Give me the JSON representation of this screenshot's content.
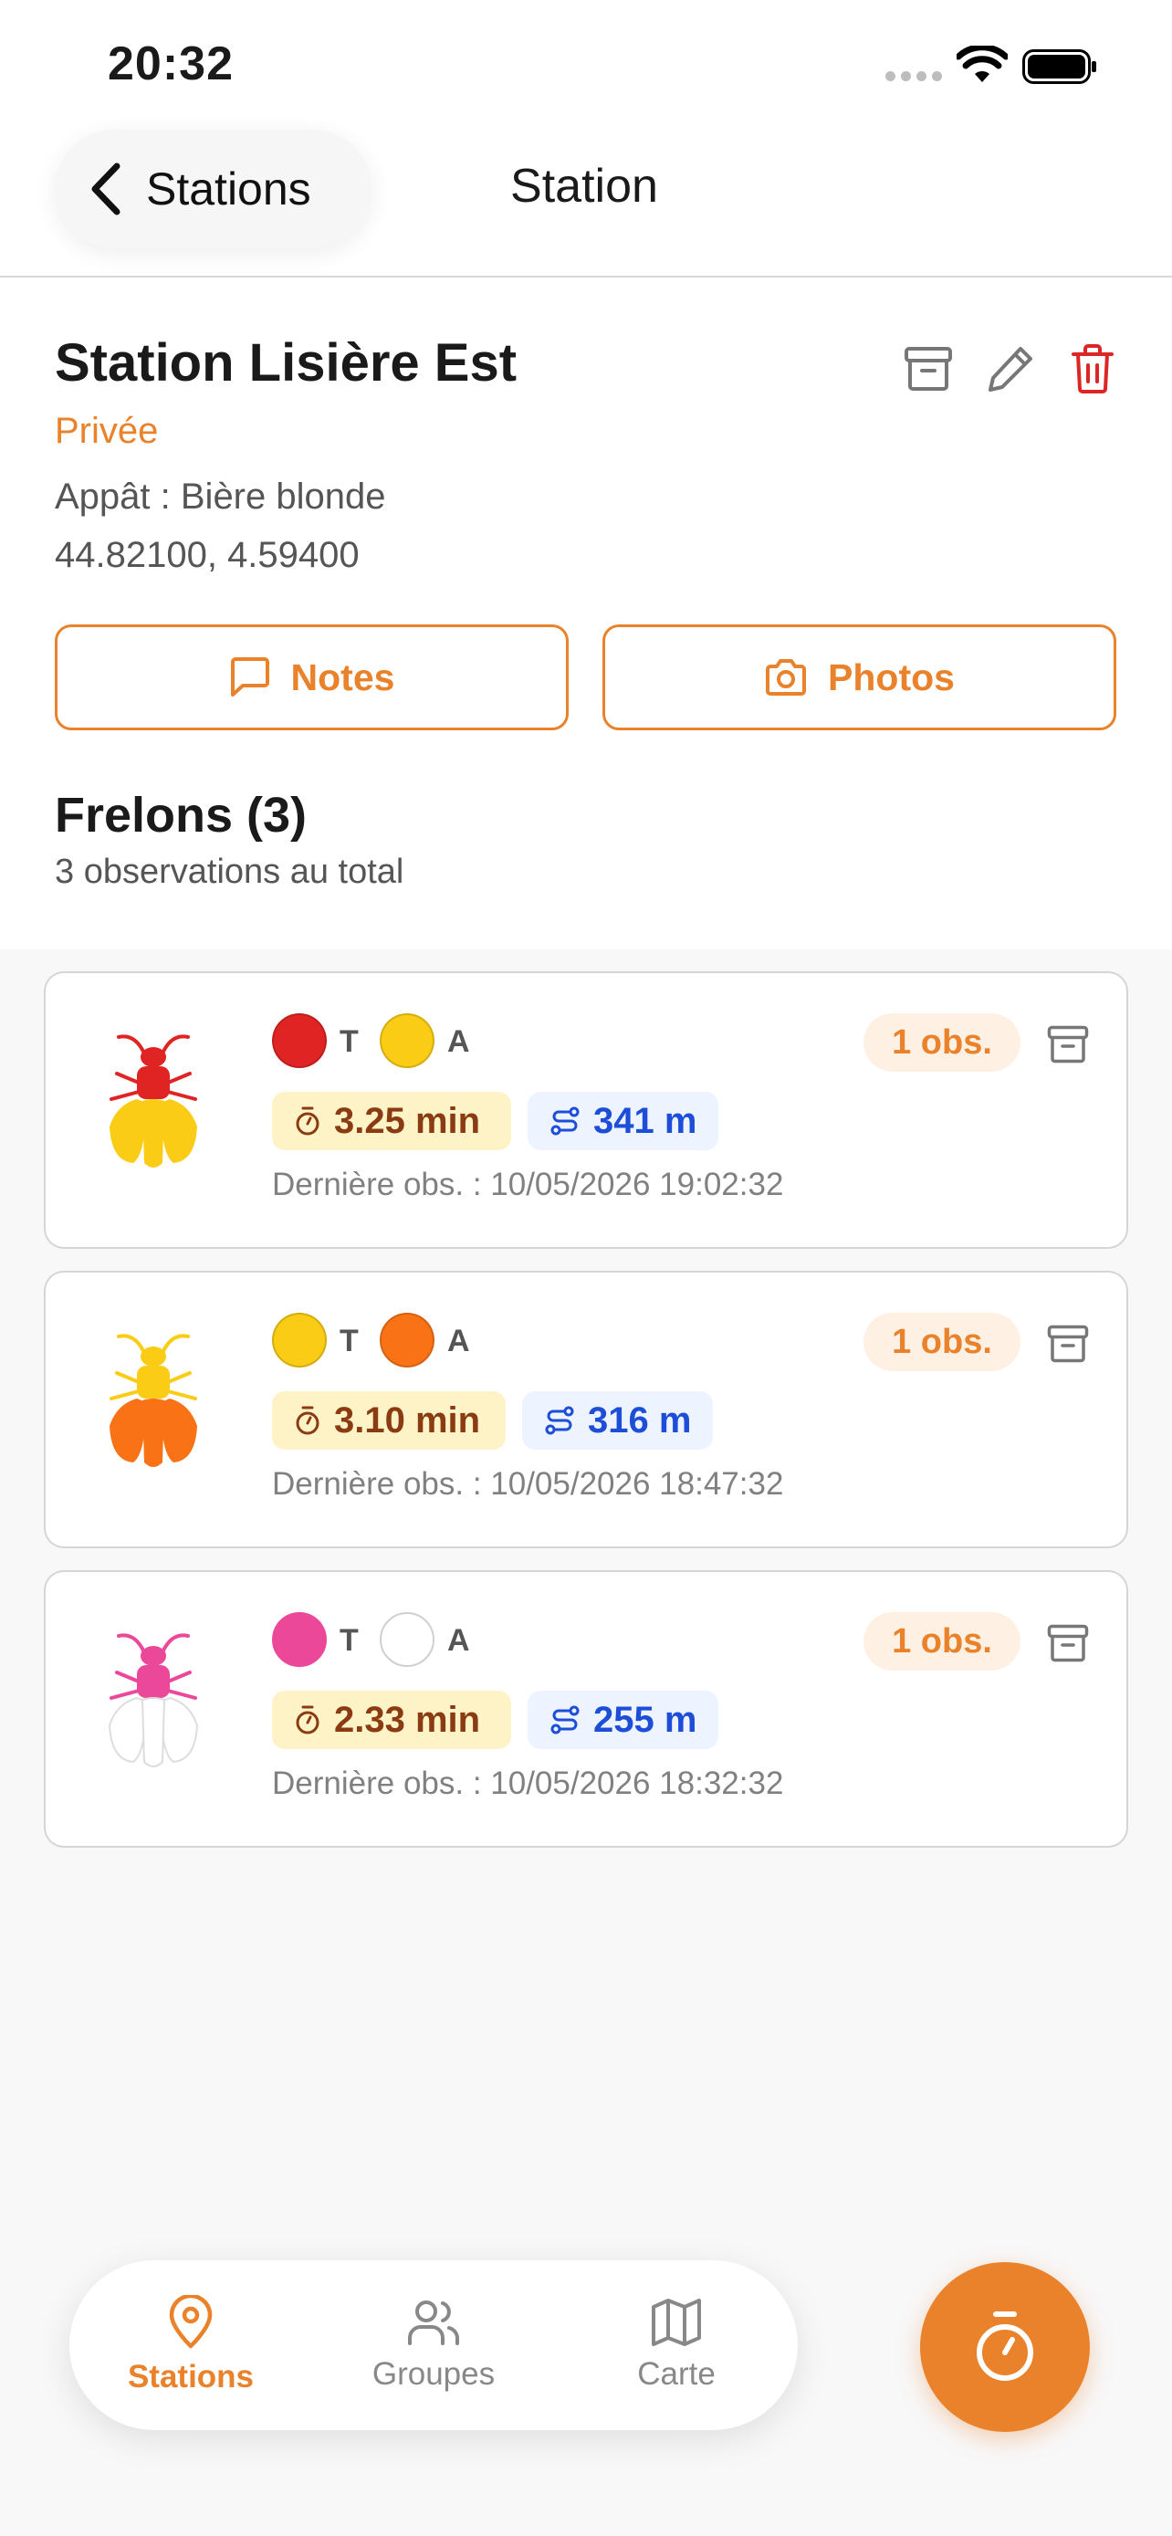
{
  "status_bar": {
    "time": "20:32"
  },
  "nav": {
    "back_label": "Stations",
    "title": "Station"
  },
  "station": {
    "name": "Station Lisière Est",
    "visibility": "Privée",
    "bait": "Appât : Bière blonde",
    "coords": "44.82100, 4.59400",
    "notes_label": "Notes",
    "photos_label": "Photos"
  },
  "section": {
    "title": "Frelons (3)",
    "subtitle": "3 observations au total"
  },
  "hornets": [
    {
      "thorax_color": "#E02424",
      "abdomen_color": "#FACC15",
      "thorax_label": "T",
      "abdomen_label": "A",
      "duration": "3.25 min",
      "distance": "341 m",
      "obs_count": "1 obs.",
      "last_obs": "Dernière obs. : 10/05/2026 19:02:32"
    },
    {
      "thorax_color": "#FACC15",
      "abdomen_color": "#F97316",
      "thorax_label": "T",
      "abdomen_label": "A",
      "duration": "3.10 min",
      "distance": "316 m",
      "obs_count": "1 obs.",
      "last_obs": "Dernière obs. : 10/05/2026 18:47:32"
    },
    {
      "thorax_color": "#EC4899",
      "abdomen_color": "#FFFFFF",
      "thorax_label": "T",
      "abdomen_label": "A",
      "duration": "2.33 min",
      "distance": "255 m",
      "obs_count": "1 obs.",
      "last_obs": "Dernière obs. : 10/05/2026 18:32:32"
    }
  ],
  "tabs": [
    {
      "label": "Stations",
      "icon": "map-pin-icon",
      "active": true
    },
    {
      "label": "Groupes",
      "icon": "users-icon",
      "active": false
    },
    {
      "label": "Carte",
      "icon": "map-icon",
      "active": false
    }
  ],
  "colors": {
    "accent": "#E9822A",
    "danger": "#DC2626"
  }
}
